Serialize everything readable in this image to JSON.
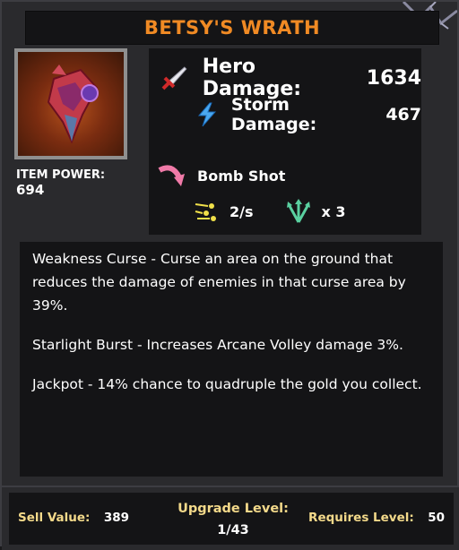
{
  "item": {
    "title": "BETSY'S WRATH",
    "power_label": "ITEM POWER:",
    "power_value": "694"
  },
  "stats": {
    "hero_damage_label": "Hero Damage:",
    "hero_damage_value": "1634",
    "storm_damage_label": "Storm Damage:",
    "storm_damage_value": "467",
    "ability_name": "Bomb Shot",
    "fire_rate": "2/s",
    "projectile_count": "x 3"
  },
  "description": [
    "Weakness Curse - Curse an area on the ground that reduces the damage of enemies in that curse area by 39%.",
    "Starlight Burst - Increases Arcane Volley damage 3%.",
    "Jackpot - 14% chance to quadruple the gold you collect."
  ],
  "footer": {
    "sell_label": "Sell Value:",
    "sell_value": "389",
    "upgrade_label": "Upgrade Level:",
    "upgrade_value": "1/43",
    "requires_label": "Requires Level:",
    "requires_value": "50"
  },
  "icons": {
    "hero_damage": "sword-icon",
    "storm_damage": "lightning-icon",
    "ability": "curved-arrow-icon",
    "fire_rate": "speed-icon",
    "projectiles": "triple-arrow-icon"
  },
  "colors": {
    "title": "#f08a24",
    "footer_labels": "#f3d98a",
    "panel": "#141416",
    "frame": "#2a2a2d"
  }
}
